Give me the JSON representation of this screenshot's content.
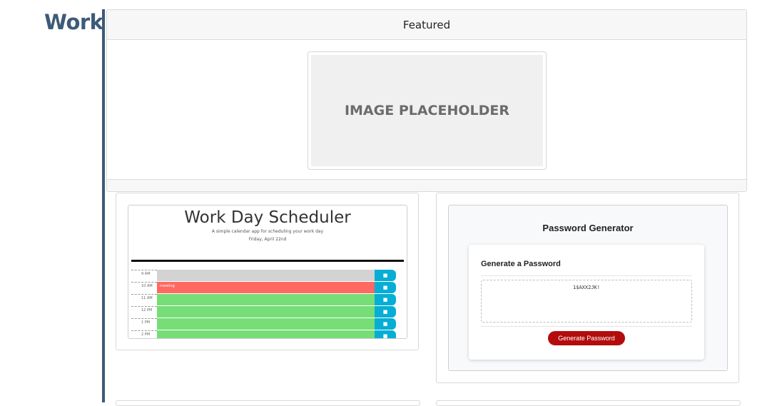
{
  "section": {
    "title": "Work"
  },
  "featured": {
    "header": "Featured",
    "placeholder_text": "IMAGE PLACEHOLDER"
  },
  "projects": [
    {
      "name": "Work Day Scheduler",
      "subtitle": "A simple calendar app for scheduling your work day",
      "date": "Friday, April 22nd",
      "rows": [
        {
          "hour": "9 AM",
          "status": "past",
          "text": ""
        },
        {
          "hour": "10 AM",
          "status": "present",
          "text": "meeting"
        },
        {
          "hour": "11 AM",
          "status": "future",
          "text": ""
        },
        {
          "hour": "12 PM",
          "status": "future",
          "text": ""
        },
        {
          "hour": "1 PM",
          "status": "future",
          "text": ""
        },
        {
          "hour": "2 PM",
          "status": "future",
          "text": ""
        }
      ],
      "status_colors": {
        "past": "#d3d3d3",
        "present": "#ff6961",
        "future": "#77dd77"
      },
      "save_color": "#06aed5"
    },
    {
      "name": "Password Generator",
      "card_header": "Generate a Password",
      "password": "1$AXX2JK!",
      "button_label": "Generate Password",
      "button_color": "#b30c0c"
    }
  ]
}
